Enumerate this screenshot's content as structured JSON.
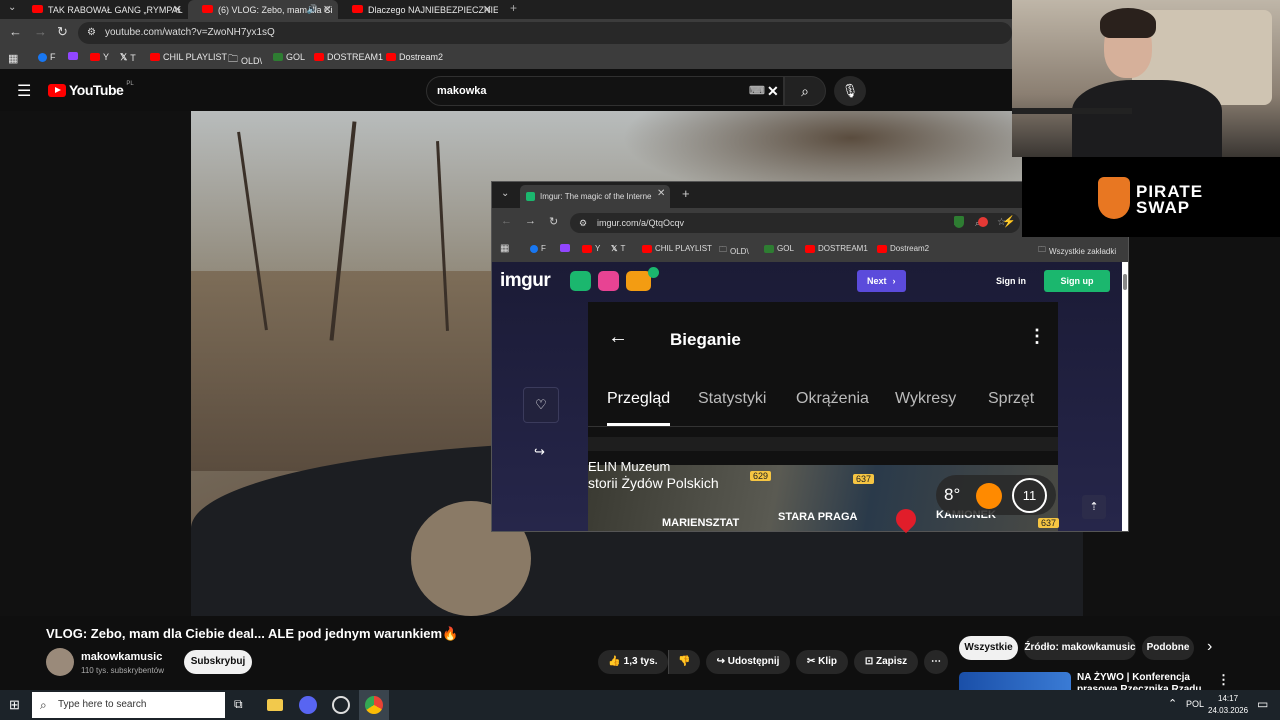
{
  "browser": {
    "tabs": [
      {
        "label": "TAK RABOWAŁ GANG „RYMPAŁ"
      },
      {
        "label": "(6) VLOG: Zebo, mam dla Ci"
      },
      {
        "label": "Dlaczego NAJNIEBEZPIECZNIE"
      }
    ],
    "url": "youtube.com/watch?v=ZwoNH7yx1sQ",
    "bookmarks": [
      "F",
      "Y",
      "T",
      "CHIL PLAYLIST",
      "OLD\\",
      "GOL",
      "DOSTREAM1",
      "Dostream2"
    ]
  },
  "youtube": {
    "logo": "YouTube",
    "region": "PL",
    "search_value": "makowka"
  },
  "imgur_window": {
    "tab_label": "Imgur: The magic of the Interne",
    "url": "imgur.com/a/QtqOcqv",
    "bookmarks": [
      "F",
      "Y",
      "T",
      "CHIL PLAYLIST",
      "OLD\\",
      "GOL",
      "DOSTREAM1",
      "Dostream2"
    ],
    "all_bookmarks": "Wszystkie zakładki",
    "logo": "imgur",
    "next_label": "Next",
    "signin_label": "Sign in",
    "signup_label": "Sign up",
    "app_title": "Bieganie",
    "app_tabs": [
      "Przegląd",
      "Statystyki",
      "Okrążenia",
      "Wykresy",
      "Sprzęt"
    ],
    "map_labels": [
      "ELIN Muzeum",
      "storii Żydów Polskich",
      "MARIENSZTAT",
      "STARA PRAGA",
      "KAMIONEK"
    ],
    "road_numbers": [
      "629",
      "637",
      "637"
    ],
    "temperature": "8°",
    "badge_number": "11"
  },
  "sponsor": {
    "line1": "PIRATE",
    "line2": "SWAP"
  },
  "video": {
    "title": "VLOG: Zebo, mam dla Ciebie deal... ALE pod jednym warunkiem🔥",
    "channel": "makowkamusic",
    "subscribers": "110 tys. subskrybentów",
    "subscribe_label": "Subskrybuj",
    "likes": "1,3 tys.",
    "share_label": "Udostępnij",
    "clip_label": "Klip",
    "save_label": "Zapisz"
  },
  "chips": [
    "Wszystkie",
    "Źródło: makowkamusic",
    "Podobne"
  ],
  "recommended": {
    "title_line1": "NA ŻYWO | Konferencja",
    "title_line2": "prasowa Rzecznika Rządu"
  },
  "taskbar": {
    "search_placeholder": "Type here to search",
    "language": "POL",
    "time": "14:17",
    "date": "24.03.2026"
  }
}
